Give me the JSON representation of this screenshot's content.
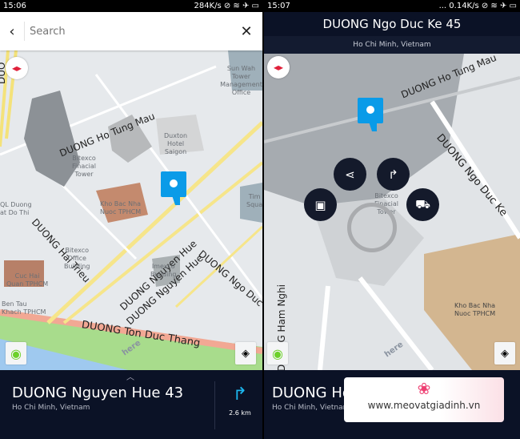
{
  "left": {
    "status": {
      "time": "15:06",
      "right": "284K/s ⊘ ≋ ✈ ▭"
    },
    "search": {
      "placeholder": "Search",
      "back_icon": "chevron-left-icon",
      "clear_icon": "close-icon"
    },
    "map": {
      "streets": [
        "DUONG Ho Tung Mau",
        "DUONG Hai Trieu",
        "DUONG Nguyen Hue",
        "DUONG Nguyen Hue",
        "DUONG Ngo Duc",
        "DUONG Ton Duc Thang",
        "DUO"
      ],
      "pois": [
        "Sun Wah Tower\nManagement\nOffice",
        "Duxton\nHotel\nSaigon",
        "Bitexco\nFinacial\nTower",
        "Kho Bac Nha\nNuoc TPHCM",
        "QL Duong\nat Do Thi",
        "Bitexco\nOffice\nBuilding",
        "Imexco\nBuilding",
        "Cuc Hai\nQuan TPHCM",
        "Ben Tau\nKhach TPHCM",
        "Tim\nSqua"
      ],
      "watermark": "here"
    },
    "place": {
      "title": "DUONG Nguyen Hue 43",
      "city": "Ho Chi Minh, Vietnam",
      "distance": "2.6 km"
    }
  },
  "right": {
    "status": {
      "time": "15:07",
      "right": "... 0.14K/s ⊘ ≋ ✈ ▭"
    },
    "header": {
      "title": "DUONG Ngo Duc Ke 45",
      "subtitle": "Ho Chi Minh, Vietnam"
    },
    "map": {
      "streets": [
        "DUONG Ho Tung Mau",
        "DUONG Ngo Duc Ke",
        "DUONG Ham Nghi"
      ],
      "pois": [
        "Bitexco\nFinacial\nTower",
        "Kho Bac Nha\nNuoc TPHCM"
      ],
      "watermark": "here"
    },
    "actions": [
      "share-icon",
      "directions-icon",
      "save-icon",
      "drive-icon"
    ],
    "place": {
      "title": "DUONG Ho",
      "city": "Ho Chi Minh, Vietnam"
    }
  },
  "watermark": {
    "text": "www.meovatgiadinh.vn"
  },
  "colors": {
    "accent": "#0a9be8",
    "panel": "#0b1226"
  }
}
